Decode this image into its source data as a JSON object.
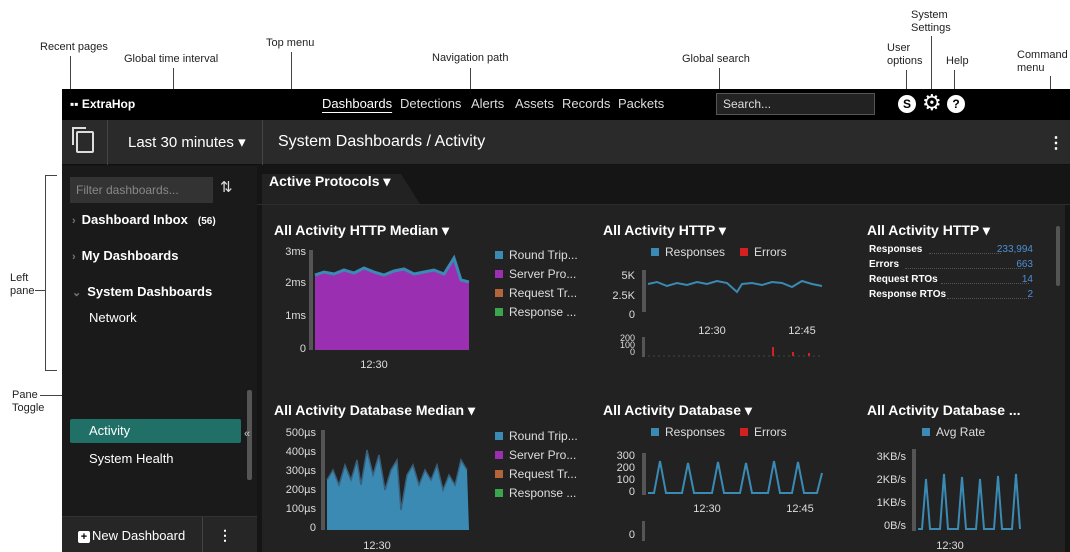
{
  "annotations": {
    "recent_pages": "Recent pages",
    "global_time_interval": "Global time interval",
    "top_menu": "Top menu",
    "navigation_path": "Navigation path",
    "global_search": "Global search",
    "user_options": "User\noptions",
    "system_settings": "System\nSettings",
    "help": "Help",
    "command_menu": "Command\nmenu",
    "left_pane": "Left\npane",
    "pane_toggle": "Pane\nToggle"
  },
  "topnav": {
    "logo": "ExtraHop",
    "links": [
      "Dashboards",
      "Detections",
      "Alerts",
      "Assets",
      "Records",
      "Packets"
    ],
    "active": "Dashboards",
    "search_value": "Search...",
    "user_icon": "S",
    "help_icon": "?"
  },
  "subbar": {
    "time_interval": "Last 30 minutes",
    "time_caret": "▾",
    "breadcrumb": "System Dashboards / Activity",
    "command_menu_icon": "⋮"
  },
  "leftpane": {
    "filter_placeholder": "Filter dashboards...",
    "sort_icon": "sort-icon",
    "items": [
      {
        "label": "Dashboard Inbox",
        "count": "(56)"
      },
      {
        "label": "My Dashboards"
      },
      {
        "label": "System Dashboards"
      },
      {
        "label": "Network"
      },
      {
        "label": "Activity"
      },
      {
        "label": "System Health"
      }
    ],
    "toggle_icon": "«",
    "new_dashboard": "New Dashboard",
    "new_dashboard_menu": "⋮"
  },
  "tab": {
    "label": "Active Protocols ▾"
  },
  "colors": {
    "purple": "#9b2fb2",
    "teal": "#3a8ab3",
    "orange": "#b2653a",
    "green": "#3aa54a",
    "blue": "#4d8fd6",
    "red": "#d32020",
    "active_row": "#207068"
  },
  "panels": {
    "http_median": {
      "title": "All Activity HTTP Median ▾",
      "yticks": [
        "3ms",
        "2ms",
        "1ms",
        "0"
      ],
      "xtick": "12:30",
      "legend": [
        "Round Trip...",
        "Server Pro...",
        "Request Tr...",
        "Response ..."
      ]
    },
    "http_chart": {
      "title": "All Activity HTTP ▾",
      "legend": [
        "Responses",
        "Errors"
      ],
      "yticks": [
        "5K",
        "2.5K",
        "0"
      ],
      "xticks": [
        "12:30",
        "12:45"
      ],
      "yticks2": [
        "200",
        "100",
        "0"
      ]
    },
    "http_list": {
      "title": "All Activity HTTP ▾",
      "rows": [
        {
          "label": "Responses",
          "value": "233,994"
        },
        {
          "label": "Errors",
          "value": "663"
        },
        {
          "label": "Request RTOs",
          "value": "14"
        },
        {
          "label": "Response RTOs",
          "value": "2"
        }
      ]
    },
    "db_median": {
      "title": "All Activity Database Median ▾",
      "yticks": [
        "500µs",
        "400µs",
        "300µs",
        "200µs",
        "100µs",
        "0"
      ],
      "xtick": "12:30",
      "legend": [
        "Round Trip...",
        "Server Pro...",
        "Request Tr...",
        "Response ..."
      ]
    },
    "db_chart": {
      "title": "All Activity Database ▾",
      "legend": [
        "Responses",
        "Errors"
      ],
      "yticks": [
        "300",
        "200",
        "100",
        "0"
      ],
      "xticks": [
        "12:30",
        "12:45"
      ],
      "ytick2": "0"
    },
    "db_rate": {
      "title": "All Activity Database ...",
      "legend": [
        "Avg Rate"
      ],
      "yticks": [
        "3KB/s",
        "2KB/s",
        "1KB/s",
        "0B/s"
      ],
      "xtick": "12:30"
    }
  }
}
